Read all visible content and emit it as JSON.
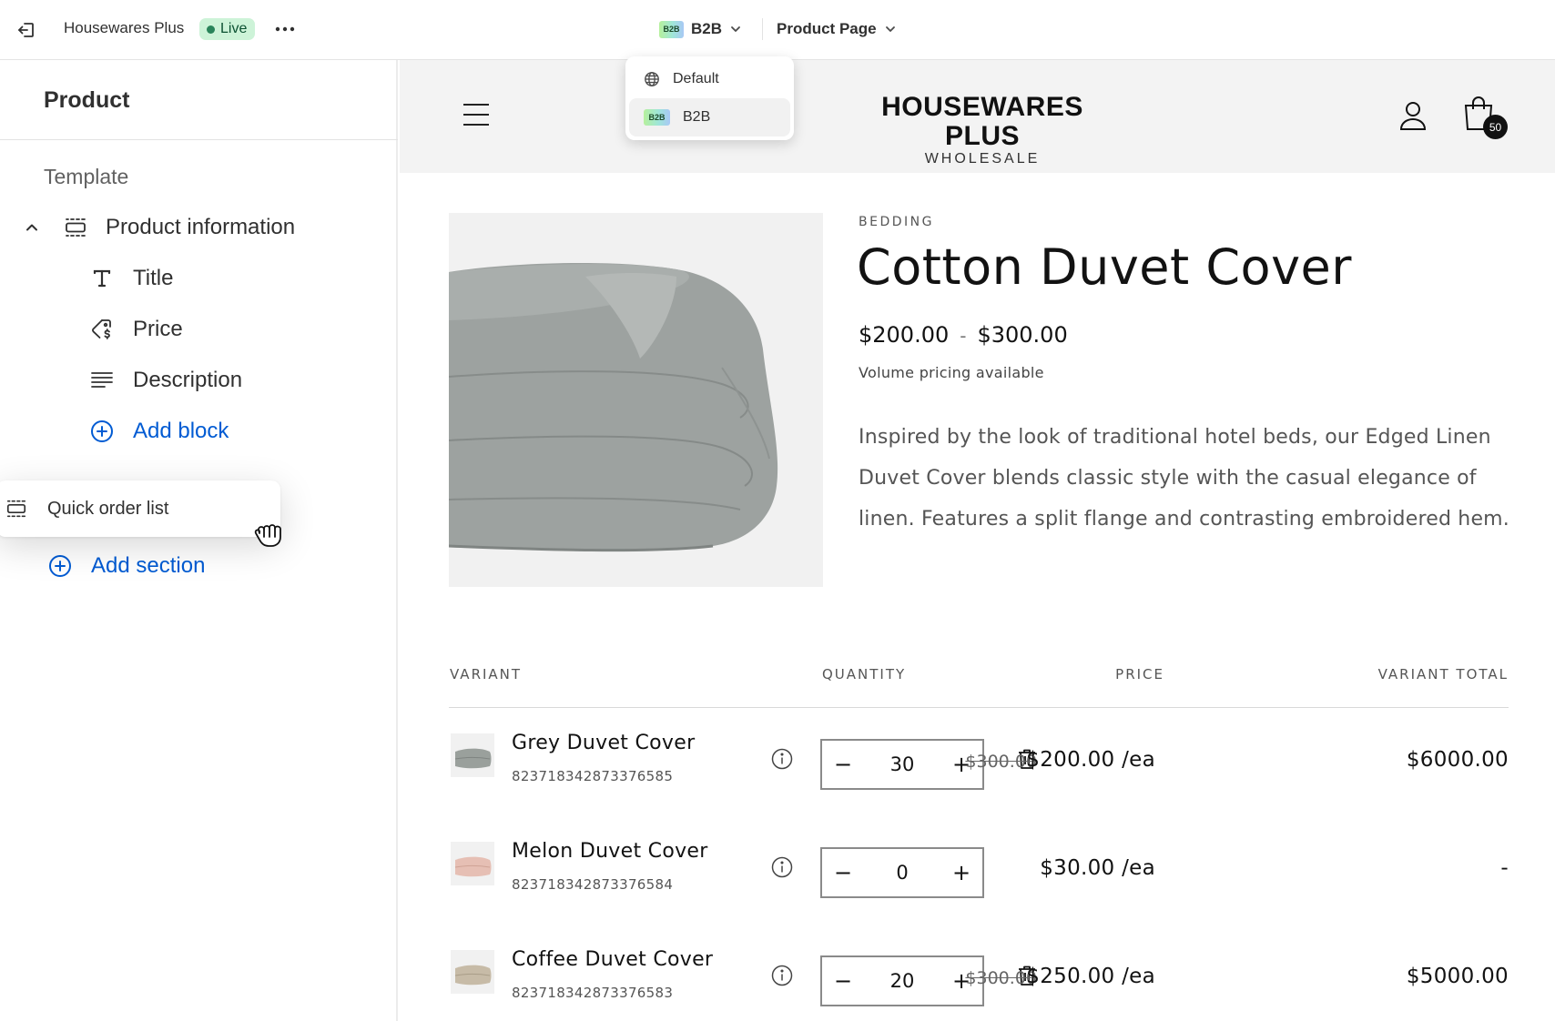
{
  "topbar": {
    "store_name": "Housewares Plus",
    "live_label": "Live",
    "market_badge": "B2B",
    "market_label": "B2B",
    "page_label": "Product Page"
  },
  "market_dropdown": {
    "items": [
      {
        "label": "Default",
        "icon": "globe-icon",
        "selected": false
      },
      {
        "label": "B2B",
        "icon": "b2b-badge",
        "badge": "B2B",
        "selected": true
      }
    ]
  },
  "sidebar": {
    "title": "Product",
    "template_label": "Template",
    "section": {
      "label": "Product information",
      "expanded": true
    },
    "blocks": [
      {
        "label": "Title",
        "icon": "text-icon"
      },
      {
        "label": "Price",
        "icon": "price-tag-icon"
      },
      {
        "label": "Description",
        "icon": "paragraph-icon"
      }
    ],
    "add_block_label": "Add block",
    "dragging_section_label": "Quick order list",
    "add_section_label": "Add section"
  },
  "store": {
    "logo_main": "HOUSEWARES PLUS",
    "logo_sub": "WHOLESALE",
    "cart_count": "50"
  },
  "product": {
    "type": "BEDDING",
    "title": "Cotton Duvet Cover",
    "price_min": "$200.00",
    "price_sep": "-",
    "price_max": "$300.00",
    "volume_note": "Volume pricing available",
    "description": "Inspired by the look of traditional hotel beds, our Edged Linen Duvet Cover blends classic style with the casual elegance of linen. Features a split flange and contrasting embroidered hem."
  },
  "quick_order": {
    "headers": {
      "variant": "VARIANT",
      "quantity": "QUANTITY",
      "price": "PRICE",
      "total": "VARIANT TOTAL"
    },
    "rows": [
      {
        "name": "Grey Duvet Cover",
        "sku": "823718342873376585",
        "qty": "30",
        "old_price": "$300.00",
        "price": "$200.00 /ea",
        "total": "$6000.00",
        "thumb_color": "#9aa09c"
      },
      {
        "name": "Melon Duvet Cover",
        "sku": "823718342873376584",
        "qty": "0",
        "old_price": "",
        "price": "$30.00 /ea",
        "total": "-",
        "thumb_color": "#e6bfb4"
      },
      {
        "name": "Coffee Duvet Cover",
        "sku": "823718342873376583",
        "qty": "20",
        "old_price": "$300.00",
        "price": "$250.00 /ea",
        "total": "$5000.00",
        "thumb_color": "#c7bba7"
      }
    ]
  },
  "colors": {
    "accent_blue": "#005bd3",
    "live_green": "#29845a",
    "live_bg": "#cdf3d8"
  }
}
